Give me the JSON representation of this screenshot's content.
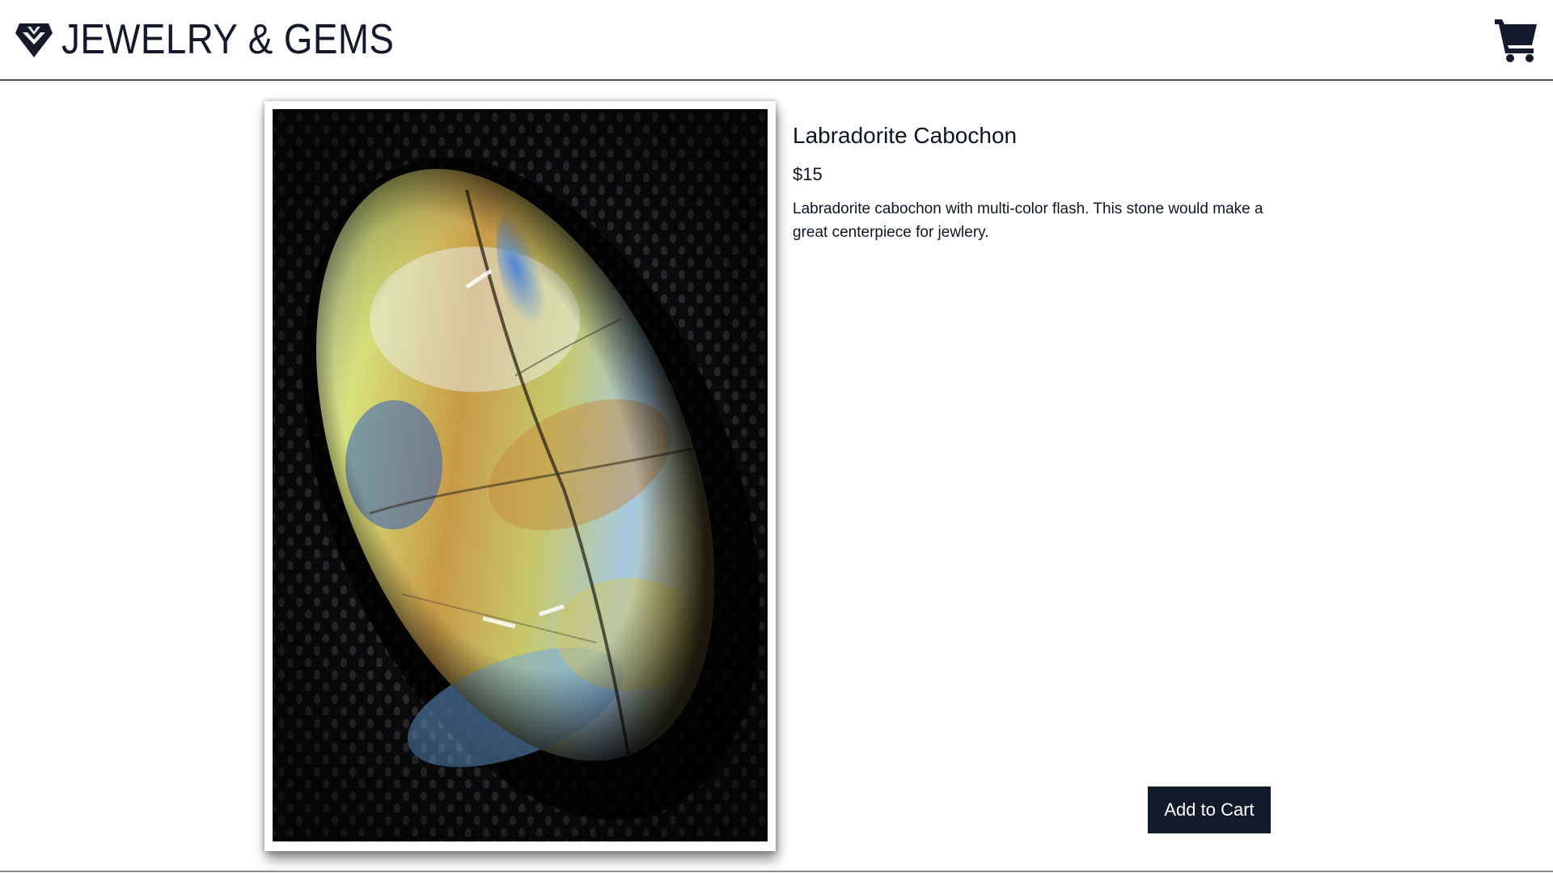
{
  "header": {
    "brand_title": "JEWELRY & GEMS",
    "brand_icon": "diamond-icon",
    "cart_icon": "shopping-cart-icon"
  },
  "product": {
    "name": "Labradorite Cabochon",
    "price": "$15",
    "description": "Labradorite cabochon with multi-color flash. This stone would make a great centerpiece for jewlery.",
    "image_alt": "Labradorite cabochon with multi-color flash",
    "add_to_cart_label": "Add to Cart"
  },
  "colors": {
    "brand_dark": "#131a2c",
    "header_border": "#4a4f58",
    "background": "#ffffff"
  }
}
